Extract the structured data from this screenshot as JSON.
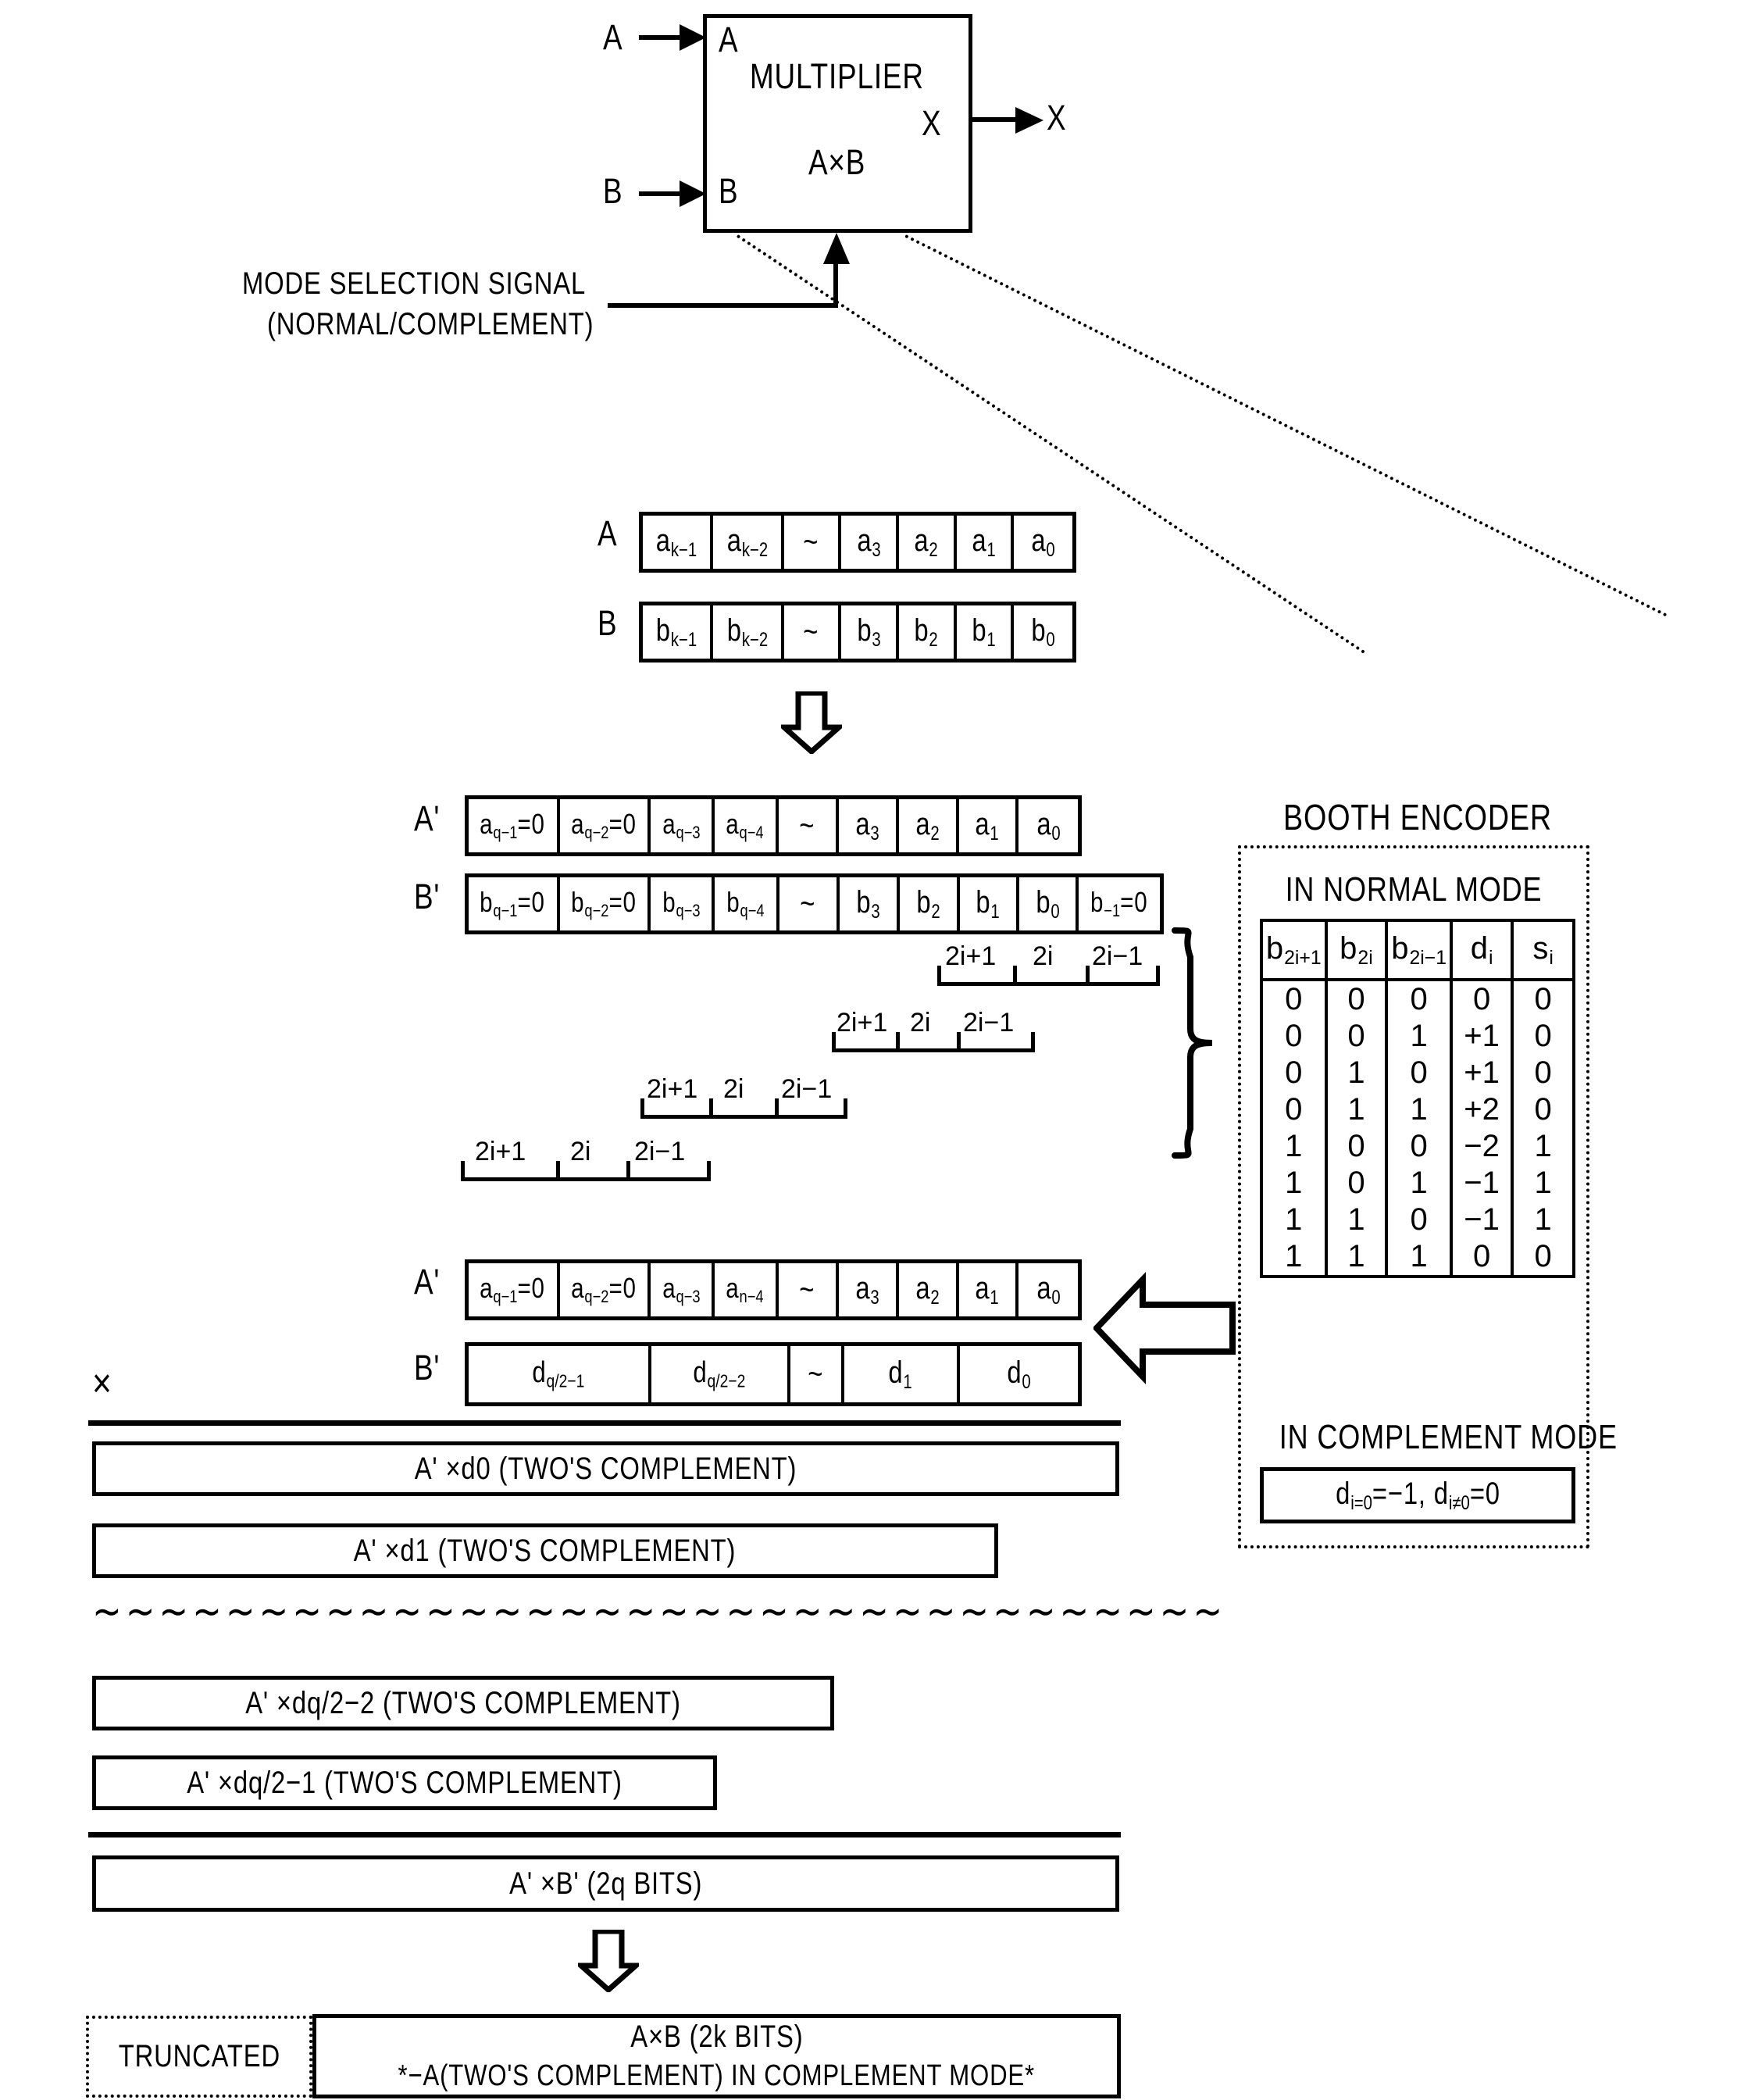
{
  "figure": {
    "multiplier_block": {
      "title": "MULTIPLIER",
      "operation": "A×B",
      "port_a_label": "A",
      "port_b_label": "B",
      "port_x_label": "X",
      "input_a": "A",
      "input_b": "B",
      "output_x": "X"
    },
    "mode_signal": {
      "line1": "MODE SELECTION SIGNAL",
      "line2": "(NORMAL/COMPLEMENT)"
    },
    "operand_rows": [
      {
        "name": "A",
        "label": "A",
        "cells": [
          "a",
          "a",
          "~",
          "a",
          "a",
          "a",
          "a"
        ],
        "cells_text": [
          "ak−1",
          "ak−2",
          "~",
          "a3",
          "a2",
          "a1",
          "a0"
        ]
      },
      {
        "name": "B",
        "label": "B",
        "cells_text": [
          "bk−1",
          "bk−2",
          "~",
          "b3",
          "b2",
          "b1",
          "b0"
        ]
      }
    ],
    "extended_rows": [
      {
        "label": "A'",
        "cells_text": [
          "aq−1=0",
          "aq−2=0",
          "aq−3",
          "aq−4",
          "~",
          "a3",
          "a2",
          "a1",
          "a0"
        ]
      },
      {
        "label": "B'",
        "cells_text": [
          "bq−1=0",
          "bq−2=0",
          "bq−3",
          "bq−4",
          "~",
          "b3",
          "b2",
          "b1",
          "b0",
          "b−1=0"
        ]
      }
    ],
    "weight_brackets": {
      "labels": [
        "2i+1",
        "2i",
        "2i−1"
      ],
      "count": 4
    },
    "encoded_rows": [
      {
        "label": "A'",
        "cells_text": [
          "aq−1=0",
          "aq−2=0",
          "aq−3",
          "an−4",
          "~",
          "a3",
          "a2",
          "a1",
          "a0"
        ]
      },
      {
        "label": "B'",
        "cells_text": [
          "dq/2−1",
          "dq/2−2",
          "~",
          "d1",
          "d0"
        ]
      }
    ],
    "booth_encoder": {
      "title": "BOOTH ENCODER",
      "normal_mode_title": "IN NORMAL MODE",
      "complement_mode_title": "IN COMPLEMENT MODE",
      "complement_mode_formula": "di=0=−1, di≠0=0",
      "table": {
        "headers": [
          "b2i+1",
          "b2i",
          "b2i−1",
          "di",
          "si"
        ],
        "rows": [
          [
            "0",
            "0",
            "0",
            "0",
            "0"
          ],
          [
            "0",
            "0",
            "1",
            "+1",
            "0"
          ],
          [
            "0",
            "1",
            "0",
            "+1",
            "0"
          ],
          [
            "0",
            "1",
            "1",
            "+2",
            "0"
          ],
          [
            "1",
            "0",
            "0",
            "−2",
            "1"
          ],
          [
            "1",
            "0",
            "1",
            "−1",
            "1"
          ],
          [
            "1",
            "1",
            "0",
            "−1",
            "1"
          ],
          [
            "1",
            "1",
            "1",
            "0",
            "0"
          ]
        ]
      }
    },
    "multiply_symbol": "×",
    "partial_products": [
      "A' ×d0  (TWO'S COMPLEMENT)",
      "A' ×d1  (TWO'S COMPLEMENT)",
      "A' ×dq/2−2  (TWO'S COMPLEMENT)",
      "A' ×dq/2−1  (TWO'S COMPLEMENT)"
    ],
    "ellipsis_wave": "∼∼∼∼∼∼∼∼∼∼∼∼∼∼∼∼∼∼∼∼∼∼∼∼∼∼∼∼∼∼∼∼∼∼",
    "product_bar": "A' ×B'  (2q BITS)",
    "final": {
      "truncated_label": "TRUNCATED",
      "line1": "A×B  (2k BITS)",
      "line2": "*−A(TWO'S COMPLEMENT)  IN COMPLEMENT MODE*"
    }
  },
  "colors": {
    "ink": "#000000",
    "paper": "#ffffff"
  }
}
